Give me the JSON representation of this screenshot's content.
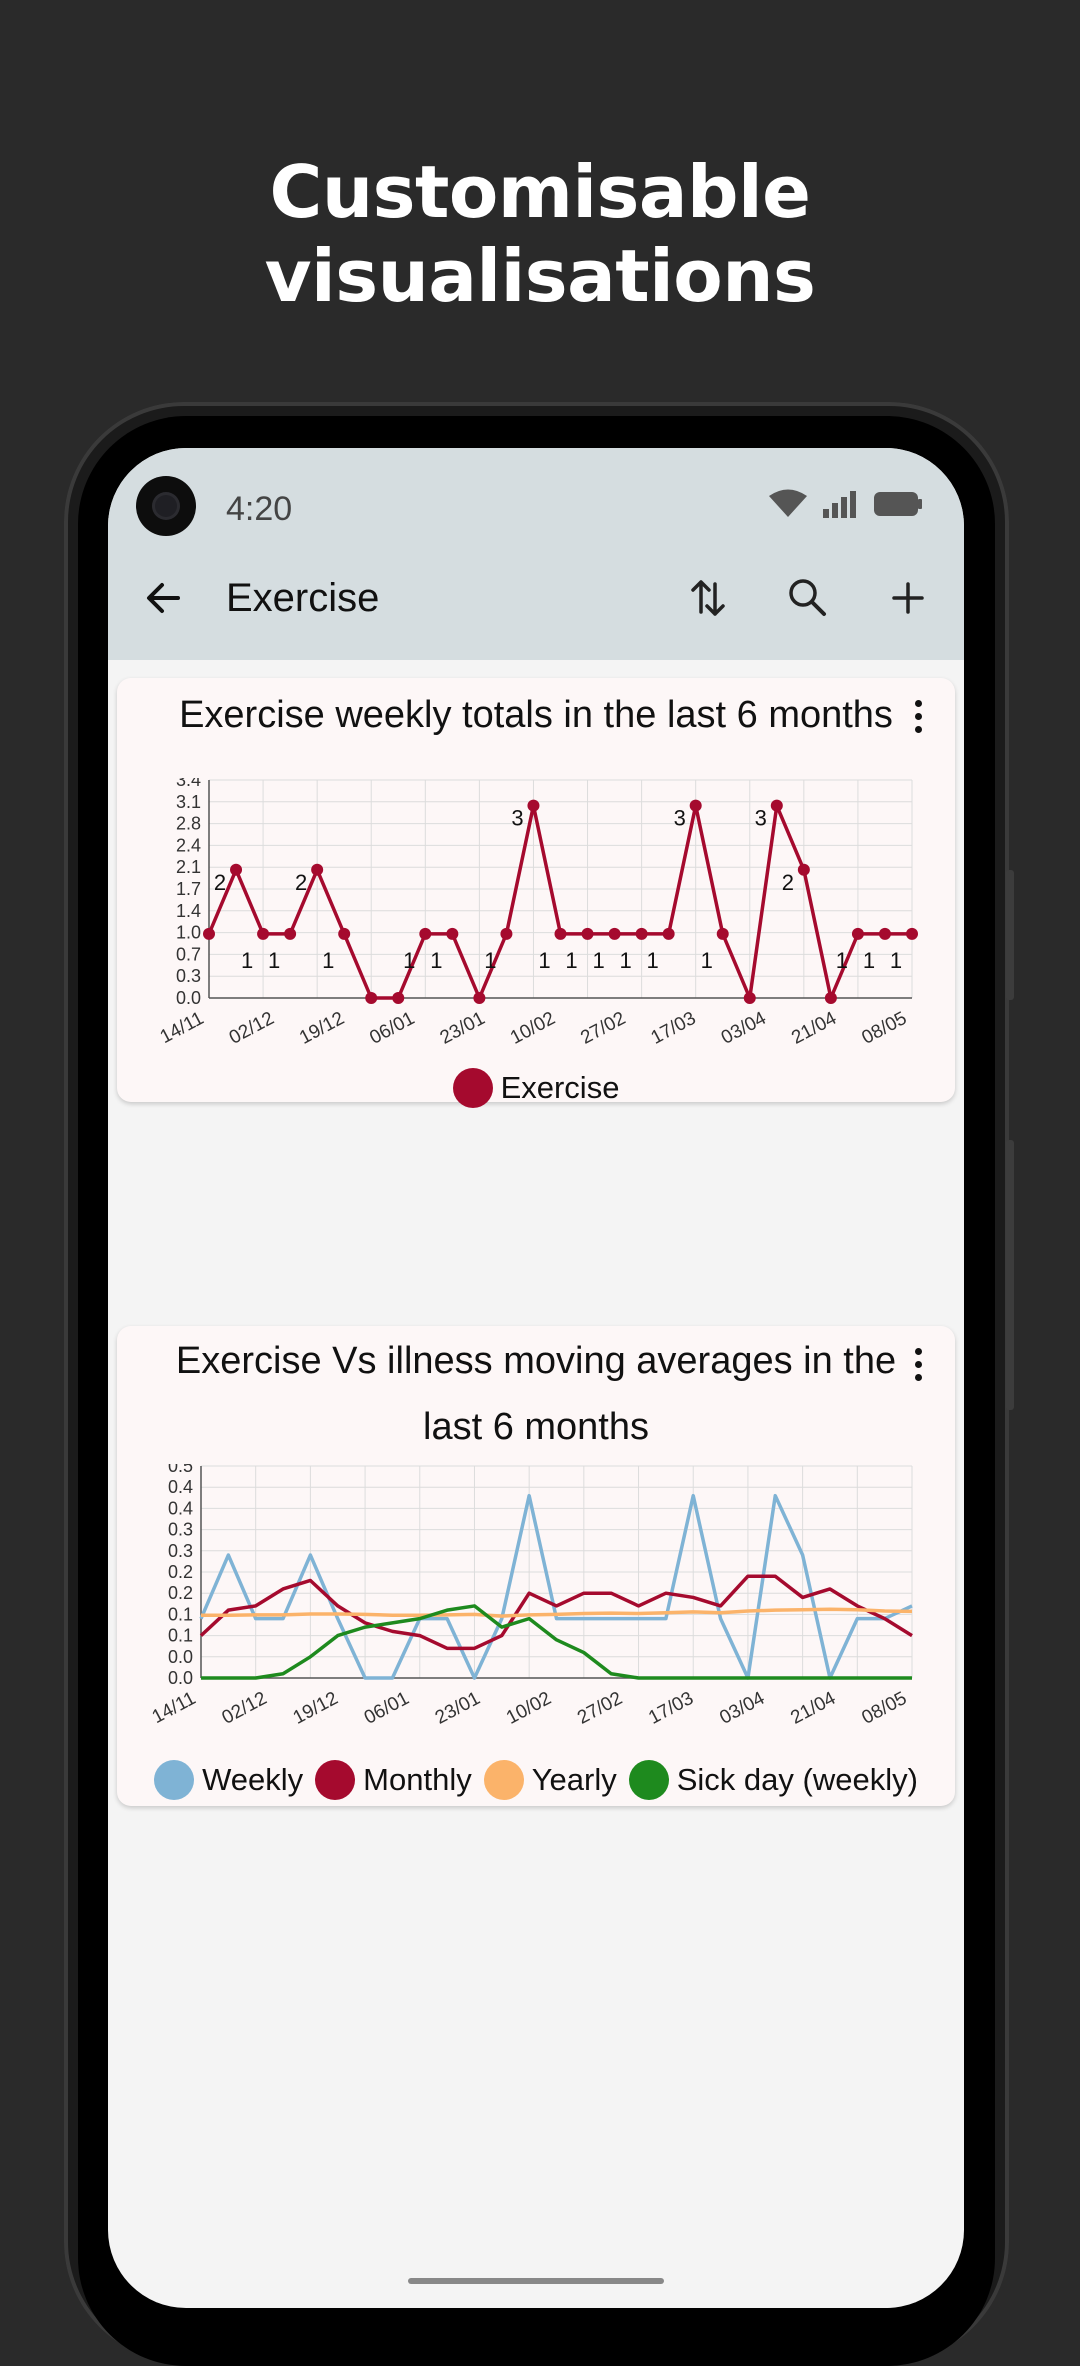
{
  "headline": "Customisable visualisations",
  "status_bar": {
    "time": "4:20",
    "icons": [
      "wifi-icon",
      "signal-icon",
      "battery-icon"
    ]
  },
  "app_bar": {
    "title": "Exercise",
    "back_icon": "arrow-left-icon",
    "actions": [
      "sort-icon",
      "search-icon",
      "add-icon"
    ]
  },
  "colors": {
    "exercise": "#a50a2e",
    "weekly": "#7fb3d5",
    "monthly": "#a50a2e",
    "yearly": "#fbb36a",
    "sick": "#1e8a1e"
  },
  "cards": [
    {
      "title": "Exercise weekly totals in the last 6 months"
    },
    {
      "title_line1": "Exercise Vs illness moving averages in the",
      "title_line2": "last 6 months"
    }
  ],
  "chart_data": [
    {
      "type": "line",
      "title": "Exercise weekly totals in the last 6 months",
      "yticks": [
        "0.0",
        "0.3",
        "0.7",
        "1.0",
        "1.4",
        "1.7",
        "2.1",
        "2.4",
        "2.8",
        "3.1",
        "3.4"
      ],
      "ylim": [
        0,
        3.4
      ],
      "xticks": [
        "14/11",
        "02/12",
        "19/12",
        "06/01",
        "23/01",
        "10/02",
        "27/02",
        "17/03",
        "03/04",
        "21/04",
        "08/05"
      ],
      "grid": true,
      "legend_position": "bottom",
      "series": [
        {
          "name": "Exercise",
          "values": [
            1,
            2,
            1,
            1,
            2,
            1,
            0,
            0,
            1,
            1,
            0,
            1,
            3,
            1,
            1,
            1,
            1,
            1,
            3,
            1,
            0,
            3,
            2,
            0,
            1,
            1,
            1
          ],
          "data_labels": [
            "",
            "2",
            "1",
            "1",
            "2",
            "1",
            "",
            "",
            "1",
            "1",
            "",
            "1",
            "3",
            "1",
            "1",
            "1",
            "1",
            "1",
            "3",
            "1",
            "",
            "3",
            "2",
            "",
            "1",
            "1",
            "1"
          ]
        }
      ]
    },
    {
      "type": "line",
      "title": "Exercise Vs illness moving averages in the last 6 months",
      "yticks": [
        "0.0",
        "0.0",
        "0.1",
        "0.1",
        "0.2",
        "0.2",
        "0.3",
        "0.3",
        "0.4",
        "0.4",
        "0.5"
      ],
      "ylim": [
        0,
        0.5
      ],
      "xticks": [
        "14/11",
        "02/12",
        "19/12",
        "06/01",
        "23/01",
        "10/02",
        "27/02",
        "17/03",
        "03/04",
        "21/04",
        "08/05"
      ],
      "grid": true,
      "legend_position": "bottom",
      "series": [
        {
          "name": "Weekly",
          "values": [
            0.14,
            0.29,
            0.14,
            0.14,
            0.29,
            0.14,
            0,
            0,
            0.14,
            0.14,
            0,
            0.14,
            0.43,
            0.14,
            0.14,
            0.14,
            0.14,
            0.14,
            0.43,
            0.14,
            0,
            0.43,
            0.29,
            0,
            0.14,
            0.14,
            0.17
          ]
        },
        {
          "name": "Monthly",
          "values": [
            0.1,
            0.16,
            0.17,
            0.21,
            0.23,
            0.17,
            0.13,
            0.11,
            0.1,
            0.07,
            0.07,
            0.1,
            0.2,
            0.17,
            0.2,
            0.2,
            0.17,
            0.2,
            0.19,
            0.17,
            0.24,
            0.24,
            0.19,
            0.21,
            0.17,
            0.14,
            0.1
          ]
        },
        {
          "name": "Yearly",
          "values": [
            0.148,
            0.148,
            0.149,
            0.149,
            0.151,
            0.151,
            0.15,
            0.148,
            0.148,
            0.149,
            0.15,
            0.146,
            0.149,
            0.15,
            0.152,
            0.153,
            0.152,
            0.154,
            0.156,
            0.154,
            0.158,
            0.16,
            0.161,
            0.162,
            0.161,
            0.158,
            0.157
          ]
        },
        {
          "name": "Sick day (weekly)",
          "values": [
            0,
            0,
            0,
            0.01,
            0.05,
            0.1,
            0.12,
            0.13,
            0.14,
            0.16,
            0.17,
            0.12,
            0.14,
            0.09,
            0.06,
            0.01,
            0,
            0,
            0,
            0,
            0,
            0,
            0,
            0,
            0,
            0,
            0
          ]
        }
      ]
    }
  ]
}
